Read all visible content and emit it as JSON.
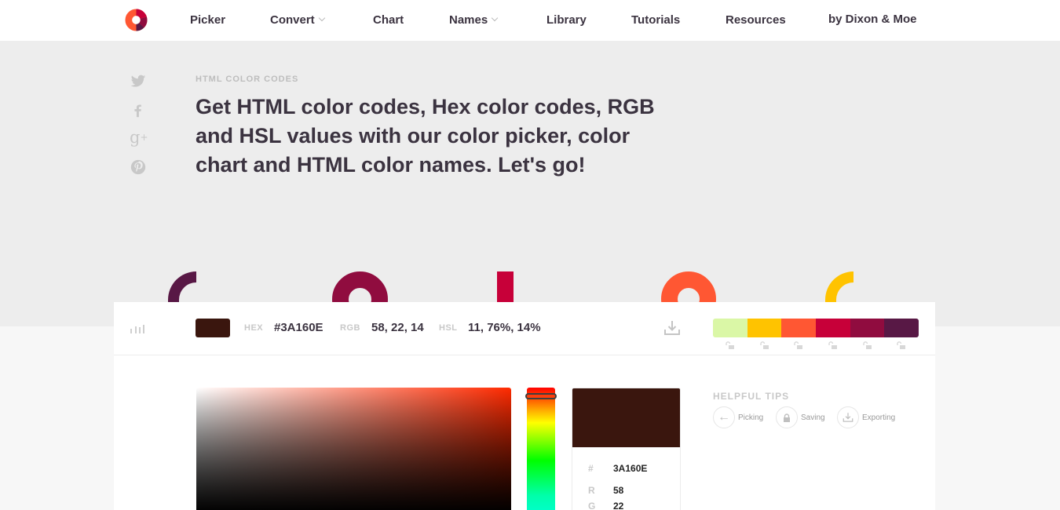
{
  "nav": {
    "logo": "color-hex-logo",
    "items": [
      {
        "label": "Picker",
        "dropdown": false
      },
      {
        "label": "Convert",
        "dropdown": true
      },
      {
        "label": "Chart",
        "dropdown": false
      },
      {
        "label": "Names",
        "dropdown": true
      },
      {
        "label": "Library",
        "dropdown": false
      },
      {
        "label": "Tutorials",
        "dropdown": false
      },
      {
        "label": "Resources",
        "dropdown": false
      },
      {
        "label": "by Dixon & Moe",
        "dropdown": false
      }
    ]
  },
  "social": [
    "twitter-icon",
    "facebook-icon",
    "google-plus-icon",
    "pinterest-icon"
  ],
  "hero": {
    "eyebrow": "HTML COLOR CODES",
    "headline": "Get HTML color codes, Hex color codes, RGB and HSL values with our color picker, color chart and HTML color names. Let's go!",
    "deco_colors": [
      "#581845",
      "#900C3F",
      "#C70039",
      "#FF5733",
      "#FFC300"
    ]
  },
  "colorbar": {
    "hex_label": "HEX",
    "hex_value": "#3A160E",
    "rgb_label": "RGB",
    "rgb_value": "58, 22, 14",
    "hsl_label": "HSL",
    "hsl_value": "11, 76%, 14%",
    "current_color": "#3A160E",
    "palette": [
      "#DAF7A6",
      "#FFC300",
      "#FF5733",
      "#C70039",
      "#900C3F",
      "#581845"
    ]
  },
  "picker": {
    "hue_color": "#FF2A00",
    "preview": {
      "hash_label": "#",
      "hex": "3A160E",
      "r_label": "R",
      "r": "58",
      "g_label": "G",
      "g": "22"
    }
  },
  "tips": {
    "title": "HELPFUL TIPS",
    "items": [
      {
        "label": "Picking",
        "icon": "arrow-left-icon"
      },
      {
        "label": "Saving",
        "icon": "lock-icon"
      },
      {
        "label": "Exporting",
        "icon": "download-icon"
      }
    ]
  }
}
